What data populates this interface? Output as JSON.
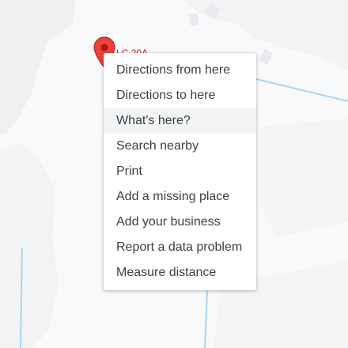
{
  "map": {
    "marker_label": "LC 20A",
    "icons": {
      "marker": "map-pin-icon"
    }
  },
  "context_menu": {
    "items": [
      {
        "label": "Directions from here"
      },
      {
        "label": "Directions to here"
      },
      {
        "label": "What's here?"
      },
      {
        "label": "Search nearby"
      },
      {
        "label": "Print"
      },
      {
        "label": "Add a missing place"
      },
      {
        "label": "Add your business"
      },
      {
        "label": "Report a data problem"
      },
      {
        "label": "Measure distance"
      }
    ],
    "highlighted_index": 2
  },
  "colors": {
    "map_background": "#f8f9fa",
    "building": "#e8eaed",
    "water_line": "#a9d4f5",
    "marker": "#ea4335",
    "marker_dark": "#b31412",
    "label": "#c5221f"
  }
}
